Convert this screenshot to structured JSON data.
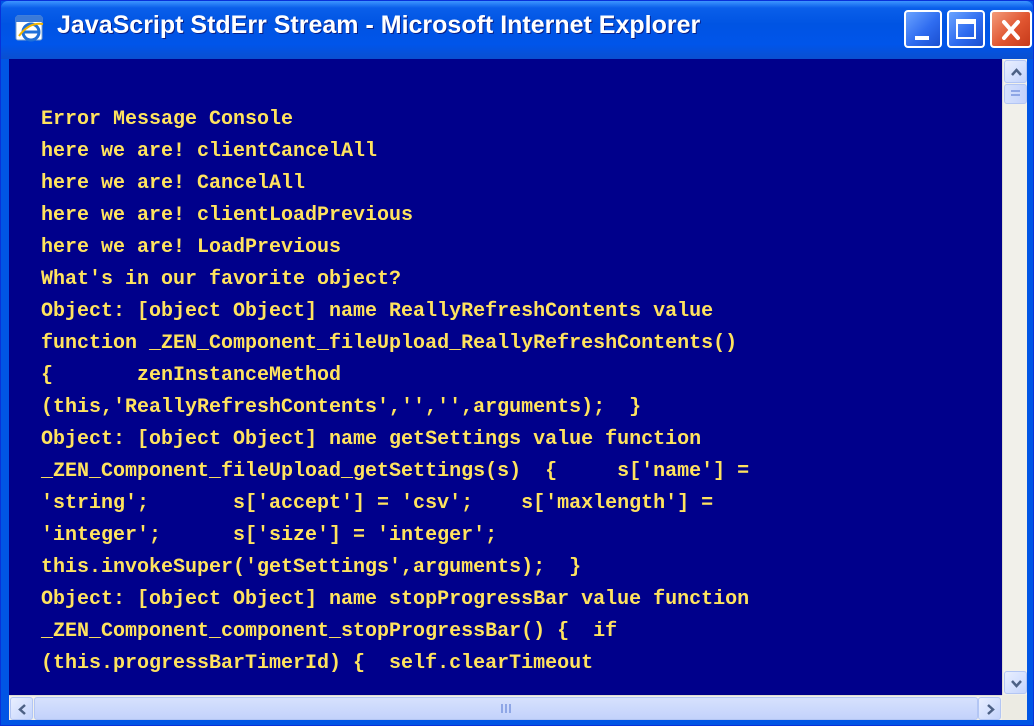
{
  "window": {
    "title": "JavaScript StdErr Stream - Microsoft Internet Explorer",
    "icon": "ie-icon",
    "controls": [
      "minimize-icon",
      "maximize-icon",
      "close-icon"
    ]
  },
  "console": {
    "background_color": "#00008b",
    "text_color": "#ffe35e",
    "lines": [
      "Error Message Console",
      "here we are! clientCancelAll",
      "here we are! CancelAll",
      "here we are! clientLoadPrevious",
      "here we are! LoadPrevious",
      "What's in our favorite object?",
      "Object: [object Object] name ReallyRefreshContents value",
      "function _ZEN_Component_fileUpload_ReallyRefreshContents()",
      "{       zenInstanceMethod",
      "(this,'ReallyRefreshContents','','',arguments);  }",
      "Object: [object Object] name getSettings value function",
      "_ZEN_Component_fileUpload_getSettings(s)  {     s['name'] =",
      "'string';       s['accept'] = 'csv';    s['maxlength'] =",
      "'integer';      s['size'] = 'integer';",
      "this.invokeSuper('getSettings',arguments);  }",
      "Object: [object Object] name stopProgressBar value function",
      "_ZEN_Component_component_stopProgressBar() {  if",
      "(this.progressBarTimerId) {  self.clearTimeout"
    ]
  },
  "scrollbars": {
    "vertical": {
      "up": "arrow-up-icon",
      "down": "arrow-down-icon"
    },
    "horizontal": {
      "left": "arrow-left-icon",
      "right": "arrow-right-icon"
    }
  }
}
